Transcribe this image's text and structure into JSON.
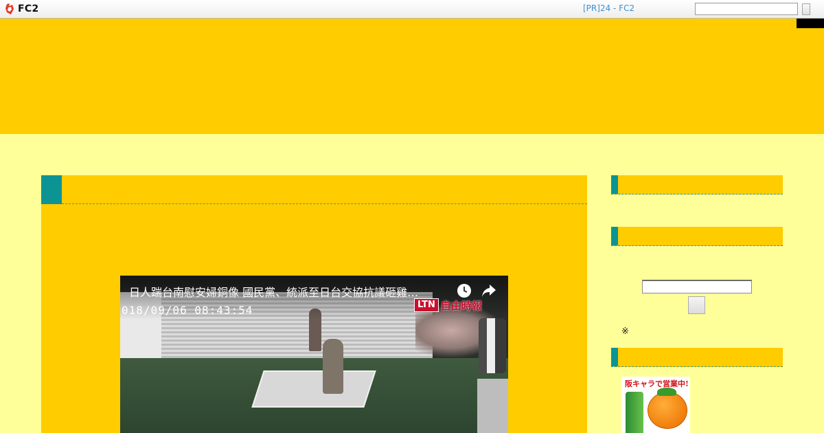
{
  "toolbar": {
    "logo_text": "FC2",
    "pr_link": "[PR]24 - FC2",
    "search_placeholder": ""
  },
  "video": {
    "title": "日人踹台南慰安婦銅像 國民黨、統派至日台交協抗議砸雞…",
    "timestamp": "018/09/06 08:43:54",
    "channel_badge": "LTN",
    "channel_name": "自由時報"
  },
  "sidebar": {
    "search_placeholder": "",
    "note_mark": "※",
    "banner_text": "阪キャラで営業中!"
  },
  "colors": {
    "page_bg": "#ffff99",
    "panel_bg": "#ffcc00",
    "accent_teal": "#0c9494",
    "link_blue": "#3d8fcf"
  },
  "icons": [
    "fc2-logo-icon",
    "clock-icon",
    "share-icon"
  ]
}
